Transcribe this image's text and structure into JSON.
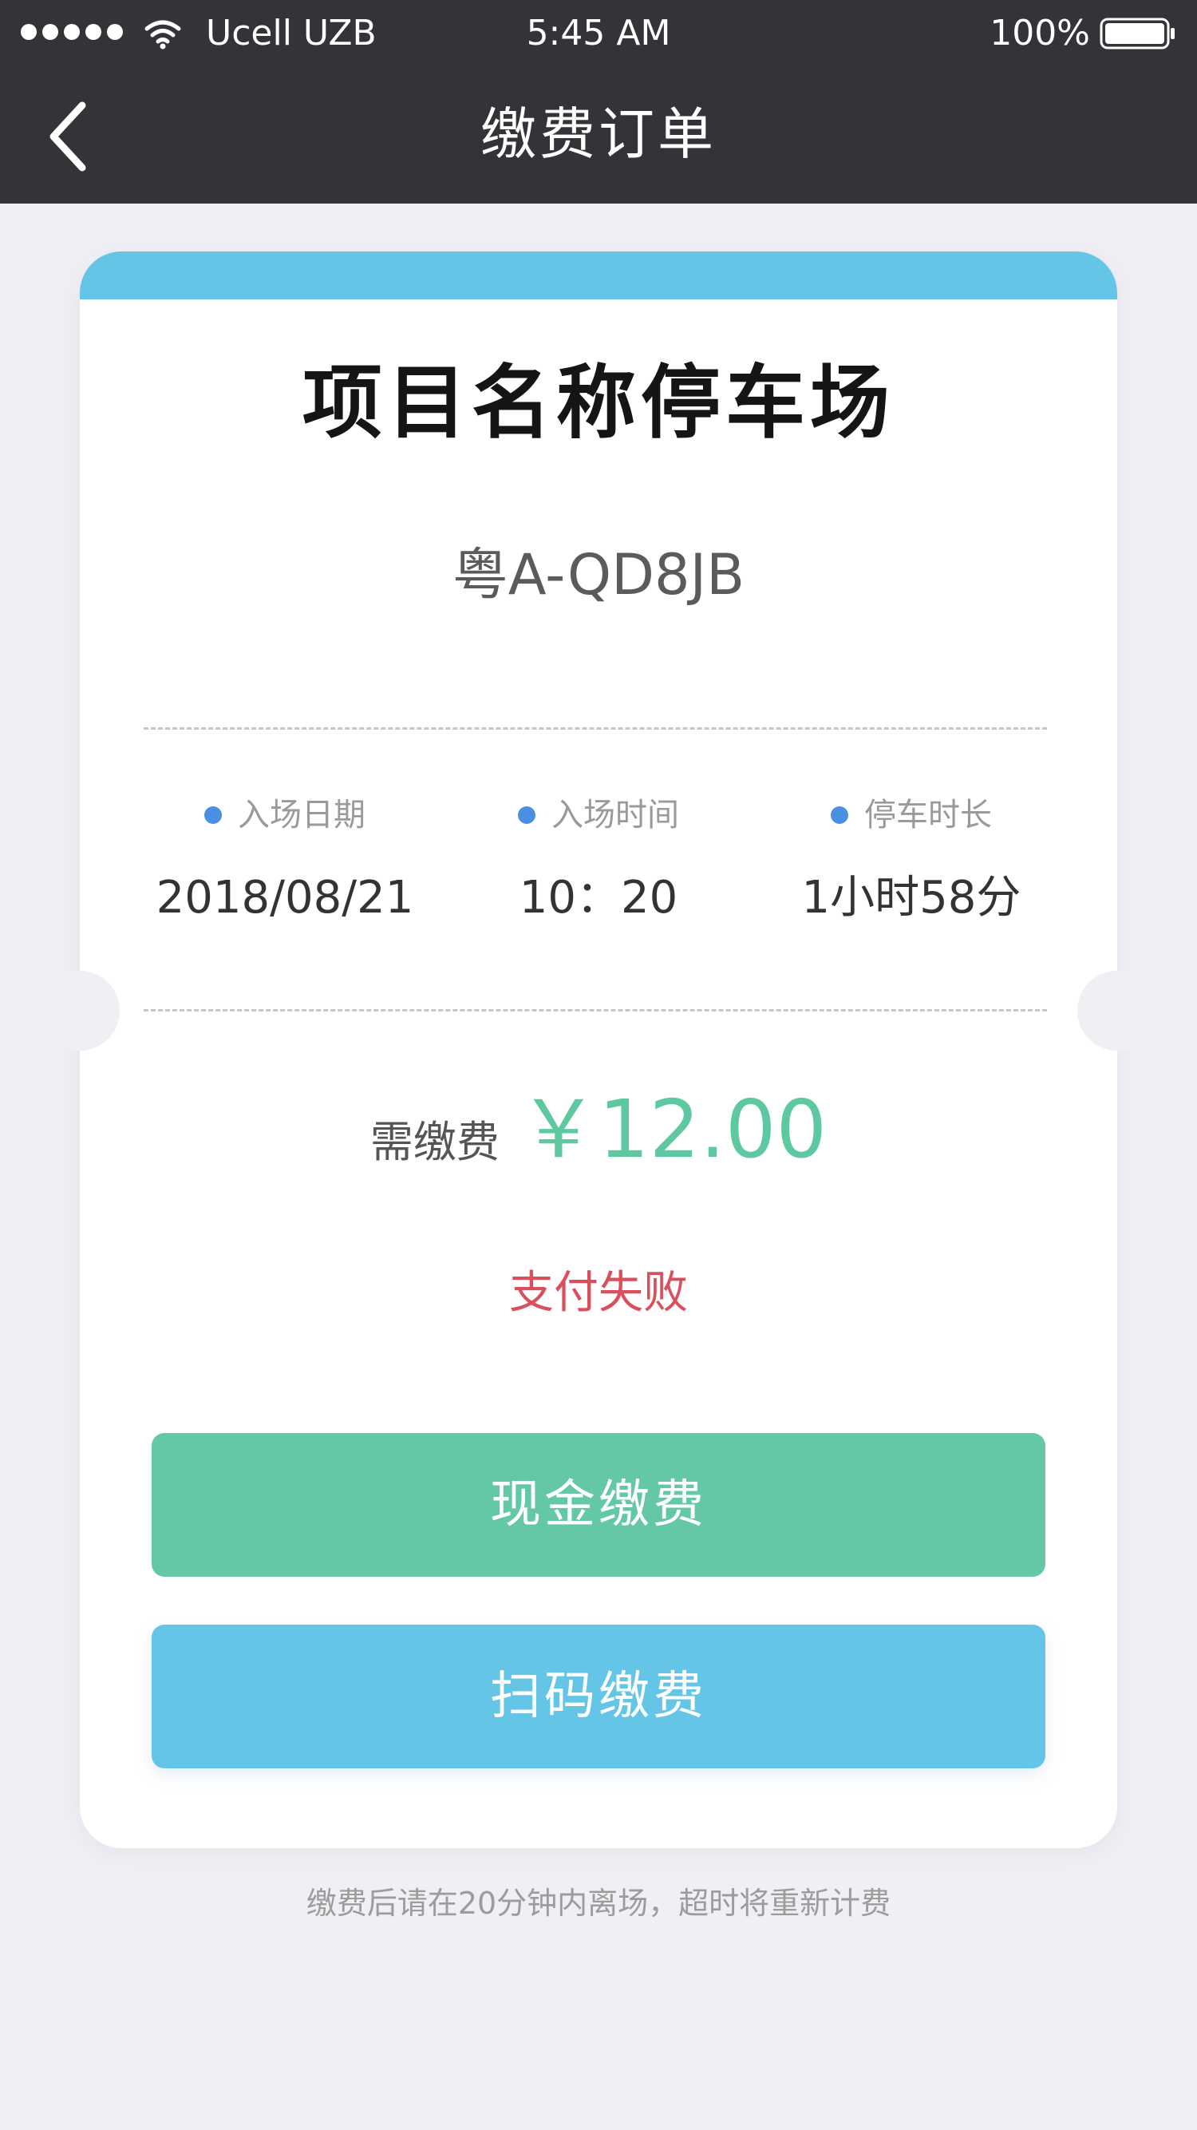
{
  "status_bar": {
    "carrier": "Ucell UZB",
    "time": "5:45 AM",
    "battery_percent": "100%",
    "signal_icon": "signal-dots-icon",
    "wifi_icon": "wifi-icon",
    "battery_icon": "battery-full-icon"
  },
  "nav": {
    "title": "缴费订单",
    "back_icon": "chevron-left-icon"
  },
  "ticket": {
    "lot_name": "项目名称停车场",
    "plate": "粤A-QD8JB",
    "info": [
      {
        "label": "入场日期",
        "value": "2018/08/21"
      },
      {
        "label": "入场时间",
        "value": "10：20"
      },
      {
        "label": "停车时长",
        "value": "1小时58分"
      }
    ],
    "fee_label": "需缴费",
    "fee_amount": "￥12.00",
    "status": "支付失败",
    "cash_button": "现金缴费",
    "scan_button": "扫码缴费"
  },
  "footnote": "缴费后请在20分钟内离场，超时将重新计费",
  "colors": {
    "nav_background": "#343438",
    "accent_blue": "#64c5e6",
    "accent_green": "#64c8a6",
    "amount_green": "#5ec8a0",
    "error_red": "#d94f5c",
    "page_background": "#efeff4"
  }
}
